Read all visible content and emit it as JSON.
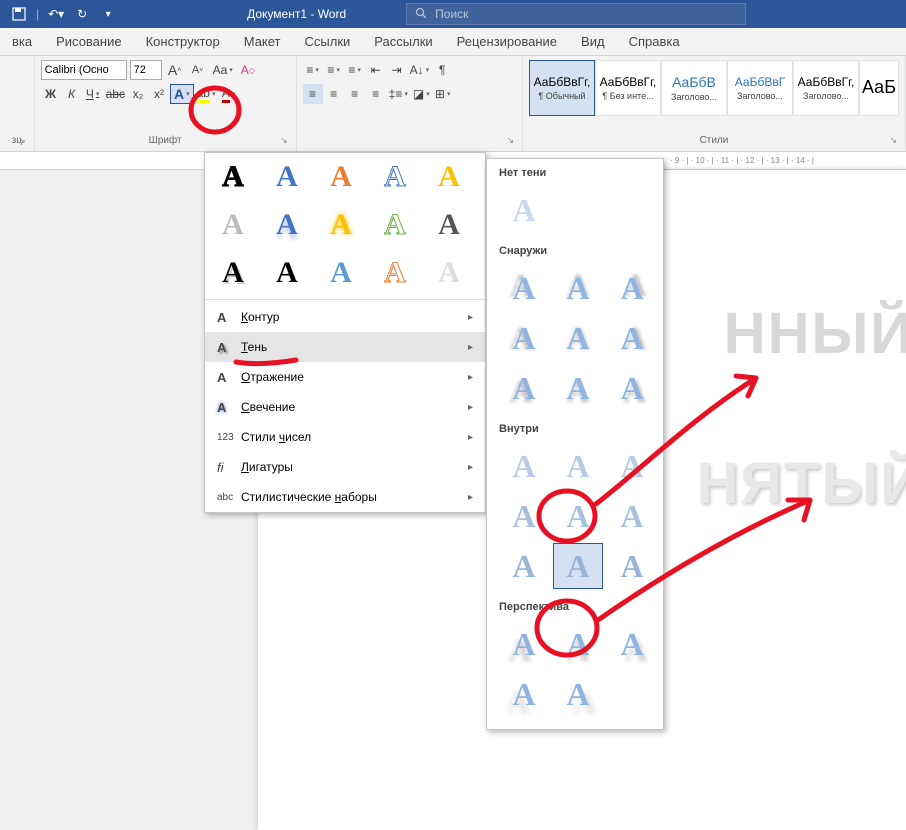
{
  "titlebar": {
    "doc_title": "Документ1 - Word",
    "search_placeholder": "Поиск"
  },
  "tabs": [
    "вка",
    "Рисование",
    "Конструктор",
    "Макет",
    "Ссылки",
    "Рассылки",
    "Рецензирование",
    "Вид",
    "Справка"
  ],
  "font_group": {
    "label": "Шрифт",
    "font_name": "Calibri (Осно",
    "font_size": "72",
    "bold": "Ж",
    "italic": "К",
    "underline": "Ч",
    "strike": "abc",
    "sub": "x₂",
    "sup": "x²",
    "grow": "A˄",
    "shrink": "A˅",
    "case": "Aa",
    "clear": "A",
    "effects": "A",
    "highlight": "A",
    "color": "A"
  },
  "para_group": {
    "label": ""
  },
  "styles_group": {
    "label": "Стили",
    "items": [
      {
        "preview": "АаБбВвГг,",
        "name": "¶ Обычный"
      },
      {
        "preview": "АаБбВвГг,",
        "name": "¶ Без инте..."
      },
      {
        "preview": "АаБбВ",
        "name": "Заголово..."
      },
      {
        "preview": "АаБбВвГ",
        "name": "Заголово..."
      },
      {
        "preview": "АаБбВвГг,",
        "name": "Заголово..."
      },
      {
        "preview": "АаБ",
        "name": ""
      }
    ]
  },
  "clipboard_label": "зц",
  "ruler_text": "· 9 · | · 10 · | · 11 · | · 12 · | · 13 · | · 14 · |",
  "doc": {
    "line1": "ННЫЙ",
    "line2": "НЯТЫЙ"
  },
  "fx_menu": {
    "items": [
      {
        "icon": "A",
        "label": "Контур",
        "key": "К"
      },
      {
        "icon": "A",
        "label": "Тень",
        "key": "Т"
      },
      {
        "icon": "A",
        "label": "Отражение",
        "key": "О"
      },
      {
        "icon": "A",
        "label": "Свечение",
        "key": "С"
      },
      {
        "icon": "123",
        "label": "Стили чисел",
        "key": "ч"
      },
      {
        "icon": "fi",
        "label": "Лигатуры",
        "key": "Л"
      },
      {
        "icon": "abc",
        "label": "Стилистические наборы",
        "key": "н"
      }
    ]
  },
  "shadow_menu": {
    "none": "Нет тени",
    "outer": "Снаружи",
    "inner": "Внутри",
    "perspective": "Перспектива"
  }
}
